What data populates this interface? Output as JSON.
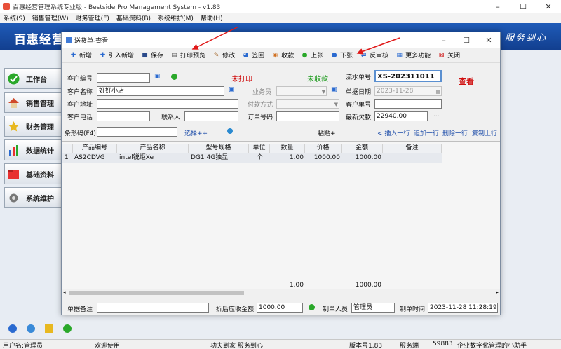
{
  "app": {
    "title": "百惠经营管理系统专业版 - Bestside Pro Management System - v1.83",
    "menu": [
      "系统(S)",
      "销售管理(W)",
      "财务管理(F)",
      "基础资料(B)",
      "系统维护(M)",
      "帮助(H)"
    ],
    "brand": "百惠经营",
    "slogan": "家 服务到心"
  },
  "sidebar": {
    "items": [
      {
        "label": "工作台",
        "icon": "check-icon",
        "color": "#2aa82a"
      },
      {
        "label": "销售管理",
        "icon": "house-icon",
        "color": "#d04a2a"
      },
      {
        "label": "财务管理",
        "icon": "star-icon",
        "color": "#e8b820"
      },
      {
        "label": "数据统计",
        "icon": "bar-chart-icon",
        "color": "#2a6ad0"
      },
      {
        "label": "基础资料",
        "icon": "folder-icon",
        "color": "#e83030"
      },
      {
        "label": "系统维护",
        "icon": "gear-icon",
        "color": "#777777"
      }
    ]
  },
  "dialog": {
    "title": "送货单-查看",
    "toolbar": [
      {
        "label": "新增",
        "icon": "plus-icon"
      },
      {
        "label": "引入新增",
        "icon": "import-icon"
      },
      {
        "label": "保存",
        "icon": "save-icon"
      },
      {
        "label": "打印预览",
        "icon": "print-icon"
      },
      {
        "label": "修改",
        "icon": "edit-icon"
      },
      {
        "label": "签回",
        "icon": "sign-icon"
      },
      {
        "label": "收款",
        "icon": "payment-icon"
      },
      {
        "label": "上张",
        "icon": "prev-icon"
      },
      {
        "label": "下张",
        "icon": "next-icon"
      },
      {
        "label": "反审核",
        "icon": "unaudit-icon"
      },
      {
        "label": "更多功能",
        "icon": "more-icon"
      },
      {
        "label": "关闭",
        "icon": "close-icon"
      }
    ],
    "form": {
      "customer_code_label": "客户编号",
      "customer_code": "",
      "customer_name_label": "客户名称",
      "customer_name": "好好小店",
      "customer_addr_label": "客户地址",
      "customer_addr": "",
      "customer_phone_label": "客户电话",
      "customer_phone": "",
      "contact_label": "联系人",
      "contact": "",
      "print_status": "未打印",
      "pay_status": "未收款",
      "salesman_label": "业务员",
      "salesman": "",
      "pay_method_label": "付款方式",
      "pay_method": "",
      "order_no_label": "订单号码",
      "order_no": "",
      "serial_label": "流水单号",
      "serial": "XS-202311011",
      "date_label": "单据日期",
      "date": "2023-11-28",
      "cust_doc_label": "客户单号",
      "cust_doc": "",
      "latest_debt_label": "最新欠款",
      "latest_debt": "22940.00",
      "view_mode": "查看",
      "barcode_label": "条形码(F4)",
      "barcode": "",
      "select_more": "选择++",
      "paste_more": "粘贴+",
      "row_actions": [
        "插入一行",
        "追加一行",
        "删除一行",
        "复制上行"
      ]
    },
    "table": {
      "columns": [
        "产品编号",
        "产品名称",
        "型号规格",
        "单位",
        "数量",
        "价格",
        "金额",
        "备注"
      ],
      "rows": [
        {
          "no": "1",
          "code": "AS2CDVG",
          "name": "intel锐炬Xe",
          "spec": "DG1 4G独显",
          "unit": "个",
          "qty": "1.00",
          "price": "1000.00",
          "amount": "1000.00",
          "note": ""
        }
      ],
      "total_qty": "1.00",
      "total_amount": "1000.00"
    },
    "footer": {
      "memo_label": "单据备注",
      "memo": "",
      "discount_label": "折后应收金额",
      "discount_amount": "1000.00",
      "maker_label": "制单人员",
      "maker": "管理员",
      "time_label": "制单时间",
      "time": "2023-11-28 11:28:19"
    }
  },
  "statusbar": {
    "user": "用户名:管理员",
    "welcome": "欢迎使用",
    "motto": "功夫到家 服务到心",
    "version": "版本号1.83",
    "server_label": "服务端",
    "server_port": "59883",
    "tagline": "企业数字化管理的小助手"
  }
}
